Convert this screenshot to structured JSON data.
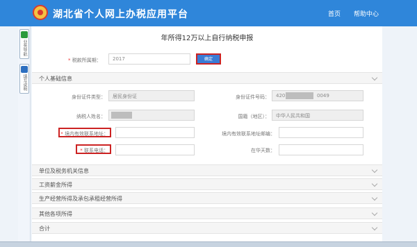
{
  "header": {
    "title": "湖北省个人网上办税应用平台",
    "nav": [
      "首页",
      "帮助中心"
    ]
  },
  "sidebar": {
    "tabs": [
      "业务导航",
      "填写说明"
    ]
  },
  "form": {
    "title": "年所得12万以上自行纳税申报",
    "tax_year": {
      "label": "税款所属期：",
      "value": "2017"
    },
    "confirm_label": "确定"
  },
  "personal": {
    "section_title": "个人基础信息",
    "id_type_label": "身份证件类型：",
    "id_type_value": "居民身份证",
    "id_number_label": "身份证件号码：",
    "id_number_prefix": "4207",
    "id_number_suffix": "0049",
    "name_label": "纳税人姓名：",
    "nationality_label": "国籍（地区）：",
    "nationality_value": "中华人民共和国",
    "address_label": "境内有效联系地址：",
    "postcode_label": "境内有效联系地址邮编：",
    "phone_label": "联系电话：",
    "days_label": "在华天数："
  },
  "sections": [
    "单位及税务机关信息",
    "工资薪金所得",
    "生产经营所得及承包承租经营所得",
    "其他各项所得",
    "合计"
  ],
  "colors": {
    "header_bg": "#2f86da",
    "highlight": "#cc2222",
    "button": "#3a7bd5"
  }
}
